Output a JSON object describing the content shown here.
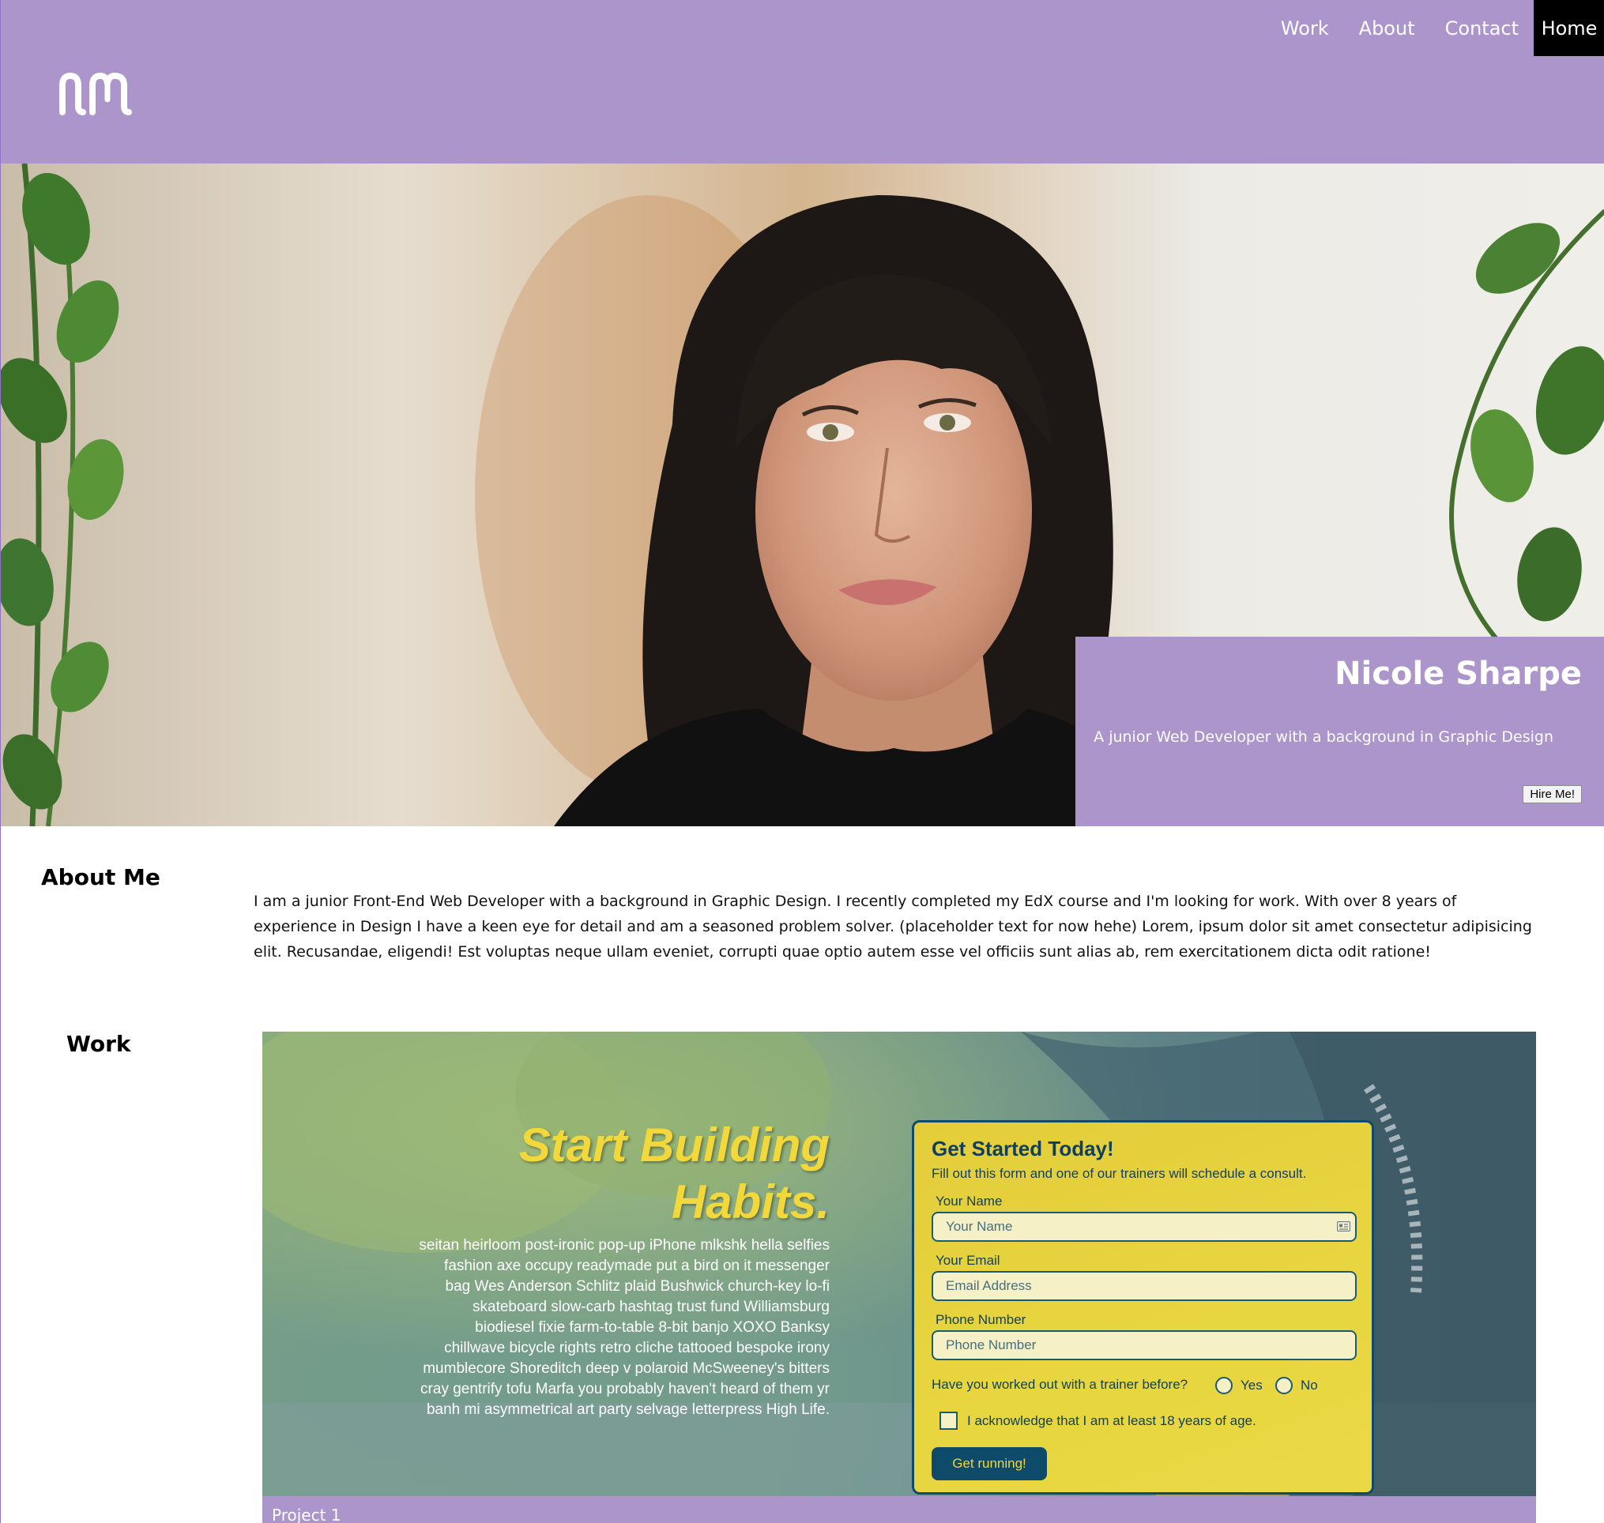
{
  "colors": {
    "brand_purple": "#ac95cb",
    "nav_active_bg": "#000000",
    "habits_yellow": "#f2d83a",
    "habits_navy": "#0e4a6a"
  },
  "header": {
    "logo_icon": "nm-monogram-logo",
    "nav": [
      {
        "label": "Work",
        "active": false
      },
      {
        "label": "About",
        "active": false
      },
      {
        "label": "Contact",
        "active": false
      },
      {
        "label": "Home",
        "active": true
      }
    ]
  },
  "hero": {
    "name": "Nicole Sharpe",
    "tagline": "A junior Web Developer with a background in Graphic Design",
    "hire_button": "Hire Me!"
  },
  "about": {
    "title": "About Me",
    "text": "I am a junior Front-End Web Developer with a background in Graphic Design. I recently completed my EdX course and I'm looking for work. With over 8 years of experience in Design I have a keen eye for detail and am a seasoned problem solver. (placeholder text for now hehe) Lorem, ipsum dolor sit amet consectetur adipisicing elit. Recusandae, eligendi! Est voluptas neque ullam eveniet, corrupti quae optio autem esse vel officiis sunt alias ab, rem exercitationem dicta odit ratione!"
  },
  "work": {
    "title": "Work",
    "project": {
      "caption": "Project 1",
      "heading_line1": "Start Building",
      "heading_line2": "Habits.",
      "body": "seitan heirloom post-ironic pop-up iPhone mlkshk hella selfies fashion axe occupy readymade put a bird on it messenger bag Wes Anderson Schlitz plaid Bushwick church-key lo-fi skateboard slow-carb hashtag trust fund Williamsburg biodiesel fixie farm-to-table 8-bit banjo XOXO Banksy chillwave bicycle rights retro cliche tattooed bespoke irony mumblecore Shoreditch deep v polaroid McSweeney's bitters cray gentrify tofu Marfa you probably haven't heard of them yr banh mi asymmetrical art party selvage letterpress High Life.",
      "form": {
        "title": "Get Started Today!",
        "subtitle": "Fill out this form and one of our trainers will schedule a consult.",
        "name_label": "Your Name",
        "name_placeholder": "Your Name",
        "email_label": "Your Email",
        "email_placeholder": "Email Address",
        "phone_label": "Phone Number",
        "phone_placeholder": "Phone Number",
        "question": "Have you worked out with a trainer before?",
        "option_yes": "Yes",
        "option_no": "No",
        "acknowledge": "I acknowledge that I am at least 18 years of age.",
        "submit": "Get running!"
      }
    }
  }
}
